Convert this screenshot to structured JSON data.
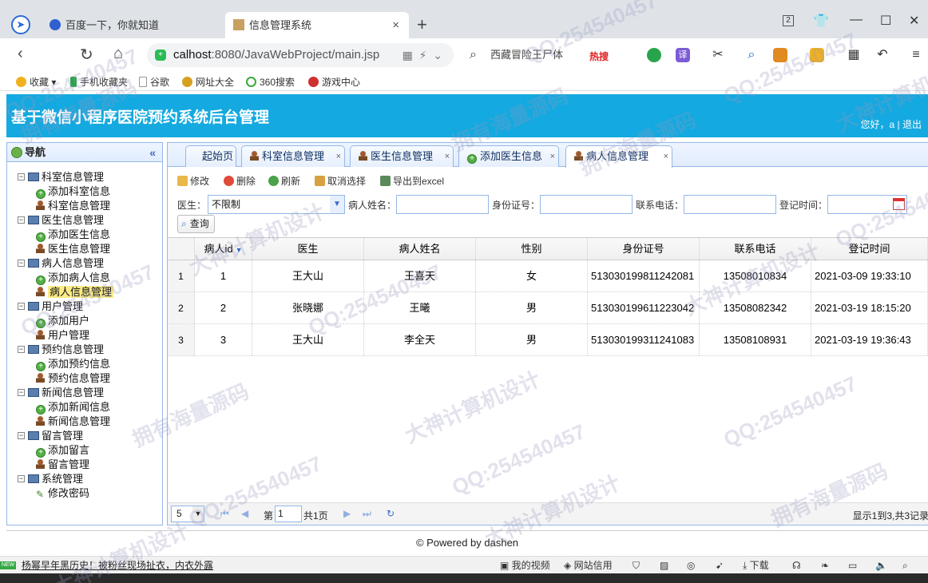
{
  "browser": {
    "tabs": [
      {
        "title": "百度一下，你就知道"
      },
      {
        "title": "信息管理系统",
        "close": "×"
      }
    ],
    "new_tab": "+",
    "window_buttons": {
      "badge": "2",
      "minimize": "—",
      "restore": "☐",
      "close": "✕"
    },
    "url_host": "calhost",
    "url_path": ":8080/JavaWebProject/main.jsp",
    "search_text": "西藏冒险王尸体",
    "hot_label": "热搜",
    "bookmarks": [
      "收藏",
      "手机收藏夹",
      "谷歌",
      "网址大全",
      "360搜索",
      "游戏中心"
    ]
  },
  "app": {
    "title": "基于微信小程序医院预约系统后台管理",
    "user_text": "您好，a | 退出"
  },
  "sidebar": {
    "title": "导航",
    "collapse": "«",
    "groups": [
      {
        "label": "科室信息管理",
        "children": [
          "添加科室信息",
          "科室信息管理"
        ]
      },
      {
        "label": "医生信息管理",
        "children": [
          "添加医生信息",
          "医生信息管理"
        ]
      },
      {
        "label": "病人信息管理",
        "children": [
          "添加病人信息",
          "病人信息管理"
        ]
      },
      {
        "label": "用户管理",
        "children": [
          "添加用户",
          "用户管理"
        ]
      },
      {
        "label": "预约信息管理",
        "children": [
          "添加预约信息",
          "预约信息管理"
        ]
      },
      {
        "label": "新闻信息管理",
        "children": [
          "添加新闻信息",
          "新闻信息管理"
        ]
      },
      {
        "label": "留言管理",
        "children": [
          "添加留言",
          "留言管理"
        ]
      },
      {
        "label": "系统管理",
        "children": [
          "修改密码"
        ]
      }
    ],
    "selected": "病人信息管理"
  },
  "tabs": [
    {
      "label": "起始页",
      "icon": "none"
    },
    {
      "label": "科室信息管理",
      "icon": "user-icon"
    },
    {
      "label": "医生信息管理",
      "icon": "user-icon"
    },
    {
      "label": "添加医生信息",
      "icon": "add-icon"
    },
    {
      "label": "病人信息管理",
      "icon": "user-icon",
      "active": true
    }
  ],
  "tab_close": "×",
  "toolbar": {
    "edit": "修改",
    "delete": "删除",
    "refresh": "刷新",
    "cancel_select": "取消选择",
    "export": "导出到excel"
  },
  "filters": {
    "doctor_label": "医生：",
    "doctor_value": "不限制",
    "patient_name_label": "病人姓名：",
    "id_card_label": "身份证号：",
    "phone_label": "联系电话：",
    "reg_time_label": "登记时间：",
    "query": "查询"
  },
  "grid": {
    "columns": [
      "病人id",
      "医生",
      "病人姓名",
      "性别",
      "身份证号",
      "联系电话",
      "登记时间"
    ],
    "rows": [
      {
        "num": "1",
        "id": "1",
        "doctor": "王大山",
        "name": "王喜天",
        "gender": "女",
        "idcard": "513030199811242081",
        "phone": "13508010834",
        "time": "2021-03-09 19:33:10"
      },
      {
        "num": "2",
        "id": "2",
        "doctor": "张晓娜",
        "name": "王曦",
        "gender": "男",
        "idcard": "513030199611223042",
        "phone": "13508082342",
        "time": "2021-03-19 18:15:20"
      },
      {
        "num": "3",
        "id": "3",
        "doctor": "王大山",
        "name": "李全天",
        "gender": "男",
        "idcard": "513030199311241083",
        "phone": "13508108931",
        "time": "2021-03-19 19:36:43"
      }
    ]
  },
  "pager": {
    "page_size": "5",
    "page_prefix": "第",
    "page_value": "1",
    "page_suffix": "共1页",
    "info": "显示1到3,共3记录"
  },
  "footer": "© Powered by dashen",
  "statusbar": {
    "news_badge": "NEW",
    "news": "杨幂早年黑历史！被粉丝现场扯衣，内衣外露",
    "video": "我的视频",
    "credit": "网站信用",
    "download": "下载"
  },
  "watermarks": [
    "QQ:254540457",
    "大神计算机设计",
    "拥有海量源码"
  ]
}
